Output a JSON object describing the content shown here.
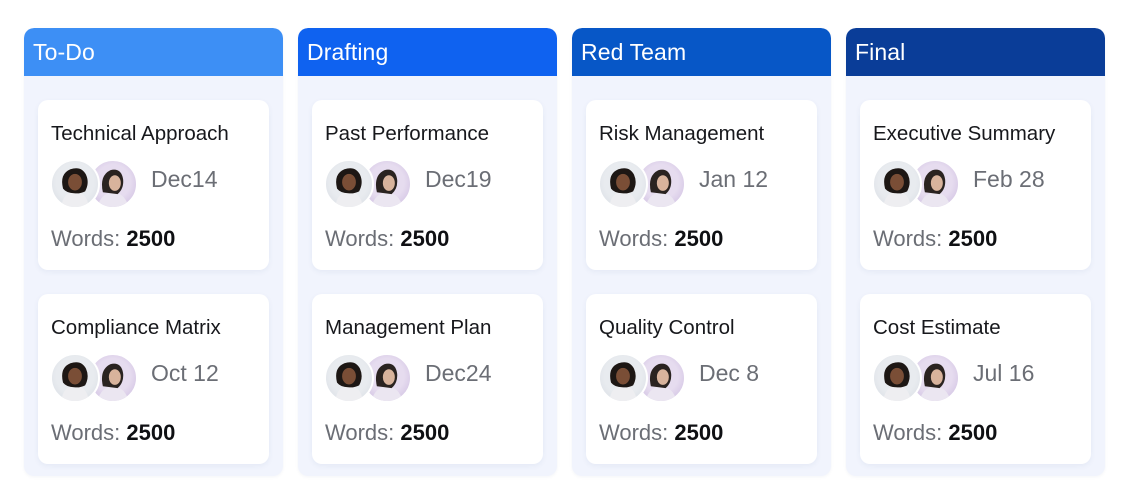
{
  "board": {
    "columns": [
      {
        "title": "To-Do",
        "color": "#3d8ff5",
        "cards": [
          {
            "title": "Technical Approach",
            "date": "Dec14",
            "words_label": "Words:",
            "words": "2500"
          },
          {
            "title": "Compliance Matrix",
            "date": "Oct 12",
            "words_label": "Words:",
            "words": "2500"
          }
        ]
      },
      {
        "title": "Drafting",
        "color": "#0f62f0",
        "cards": [
          {
            "title": "Past Performance",
            "date": "Dec19",
            "words_label": "Words:",
            "words": "2500"
          },
          {
            "title": "Management Plan",
            "date": "Dec24",
            "words_label": "Words:",
            "words": "2500"
          }
        ]
      },
      {
        "title": "Red Team",
        "color": "#0757c7",
        "cards": [
          {
            "title": "Risk Management",
            "date": "Jan 12",
            "words_label": "Words:",
            "words": "2500"
          },
          {
            "title": "Quality Control",
            "date": "Dec 8",
            "words_label": "Words:",
            "words": "2500"
          }
        ]
      },
      {
        "title": "Final",
        "color": "#0a3d98",
        "cards": [
          {
            "title": "Executive Summary",
            "date": "Feb 28",
            "words_label": "Words:",
            "words": "2500"
          },
          {
            "title": "Cost Estimate",
            "date": "Jul 16",
            "words_label": "Words:",
            "words": "2500"
          }
        ]
      }
    ]
  },
  "avatars": [
    "avatar-person-1",
    "avatar-person-2"
  ]
}
